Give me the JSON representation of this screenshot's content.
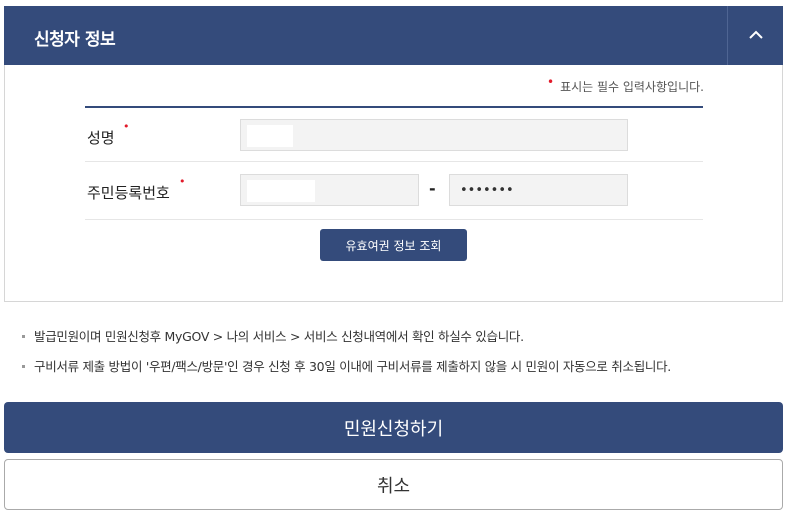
{
  "section": {
    "title": "신청자 정보",
    "collapse_icon": "chevron-up-icon"
  },
  "form": {
    "required_dot": "•",
    "required_note": "표시는 필수 입력사항입니다.",
    "name": {
      "label": "성명",
      "value": ""
    },
    "rrn": {
      "label": "주민등록번호",
      "front_value": "",
      "separator": "-",
      "back_value": "•••••••"
    },
    "lookup_button": "유효여권 정보 조회"
  },
  "notes": [
    "발급민원이며 민원신청후 MyGOV > 나의 서비스 > 서비스 신청내역에서 확인 하실수 있습니다.",
    "구비서류 제출 방법이 '우편/팩스/방문'인 경우 신청 후 30일 이내에 구비서류를 제출하지 않을 시 민원이 자동으로 취소됩니다."
  ],
  "actions": {
    "submit": "민원신청하기",
    "cancel": "취소"
  },
  "colors": {
    "primary": "#344b7b",
    "required": "#e21b2b"
  }
}
